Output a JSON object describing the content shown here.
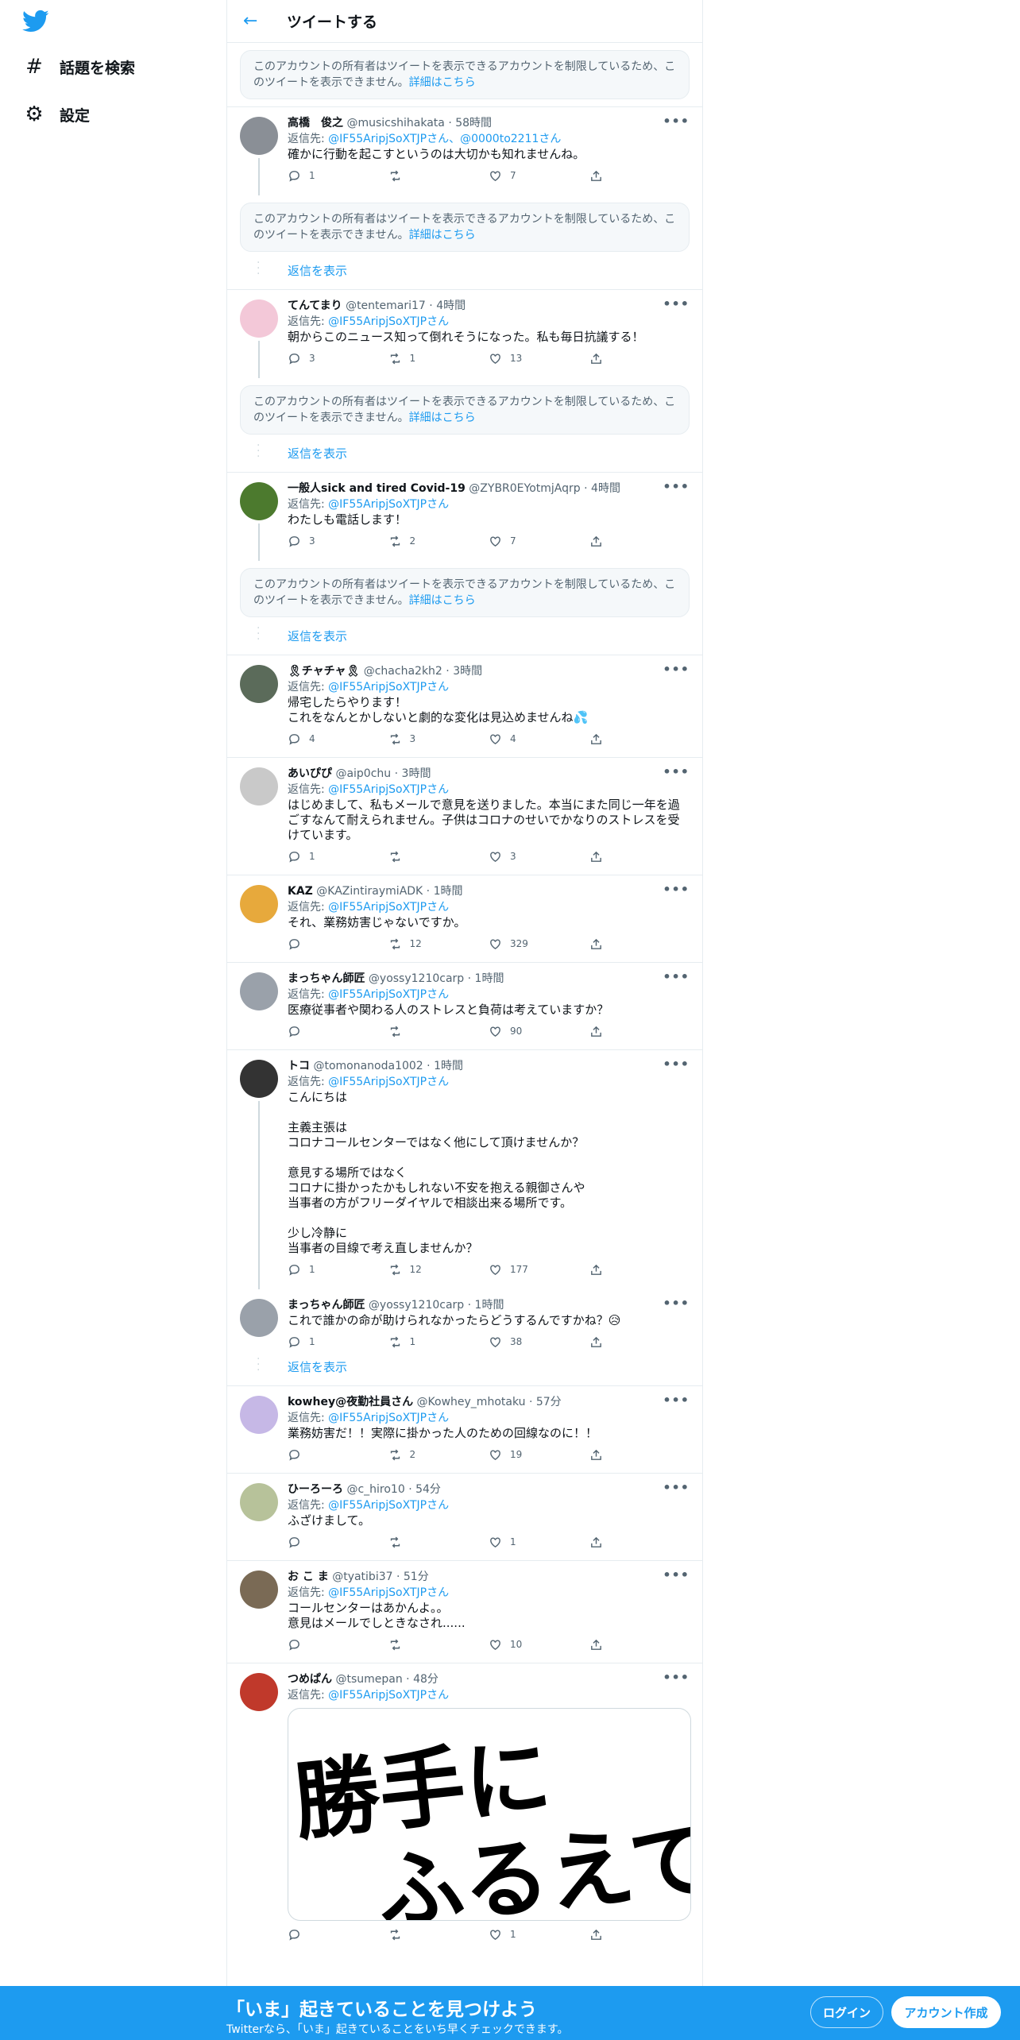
{
  "nav": {
    "explore": "話題を検索",
    "settings": "設定"
  },
  "header": {
    "title": "ツイートする"
  },
  "restricted": {
    "text": "このアカウントの所有者はツイートを表示できるアカウントを制限しているため、このツイートを表示できません。",
    "link": "詳細はこちら"
  },
  "show_replies": "返信を表示",
  "replying_to_label": "返信先:",
  "tweets": [
    {
      "name": "高橋　俊之",
      "handle": "@musicshihakata",
      "time": "58時間",
      "reply_to": "@IF55AripjSoXTJPさん、@0000to2211さん",
      "text": "確かに行動を起こすというのは大切かも知れませんね。",
      "replies": "1",
      "retweets": "",
      "likes": "7"
    },
    {
      "name": "てんてまり",
      "handle": "@tentemari17",
      "time": "4時間",
      "reply_to": "@IF55AripjSoXTJPさん",
      "text": "朝からこのニュース知って倒れそうになった。私も毎日抗議する！",
      "replies": "3",
      "retweets": "1",
      "likes": "13"
    },
    {
      "name": "一般人sick and tired Covid-19",
      "handle": "@ZYBR0EYotmjAqrp",
      "time": "4時間",
      "reply_to": "@IF55AripjSoXTJPさん",
      "text": "わたしも電話します！",
      "replies": "3",
      "retweets": "2",
      "likes": "7"
    },
    {
      "name": "🎗チャチャ🎗",
      "handle": "@chacha2kh2",
      "time": "3時間",
      "reply_to": "@IF55AripjSoXTJPさん",
      "text": "帰宅したらやります！\nこれをなんとかしないと劇的な変化は見込めませんね💦",
      "replies": "4",
      "retweets": "3",
      "likes": "4"
    },
    {
      "name": "あいぴぴ",
      "handle": "@aip0chu",
      "time": "3時間",
      "reply_to": "@IF55AripjSoXTJPさん",
      "text": "はじめまして、私もメールで意見を送りました。本当にまた同じ一年を過ごすなんて耐えられません。子供はコロナのせいでかなりのストレスを受けています。",
      "replies": "1",
      "retweets": "",
      "likes": "3"
    },
    {
      "name": "KAZ",
      "handle": "@KAZintiraymiADK",
      "time": "1時間",
      "reply_to": "@IF55AripjSoXTJPさん",
      "text": "それ、業務妨害じゃないですか。",
      "replies": "",
      "retweets": "12",
      "likes": "329"
    },
    {
      "name": "まっちゃん師匠",
      "handle": "@yossy1210carp",
      "time": "1時間",
      "reply_to": "@IF55AripjSoXTJPさん",
      "text": "医療従事者や関わる人のストレスと負荷は考えていますか？",
      "replies": "",
      "retweets": "",
      "likes": "90"
    },
    {
      "name": "トコ",
      "handle": "@tomonanoda1002",
      "time": "1時間",
      "reply_to": "@IF55AripjSoXTJPさん",
      "text": "こんにちは\n\n主義主張は\nコロナコールセンターではなく他にして頂けませんか？\n\n意見する場所ではなく\nコロナに掛かったかもしれない不安を抱える親御さんや\n当事者の方がフリーダイヤルで相談出来る場所です。\n\n少し冷静に\n当事者の目線で考え直しませんか？",
      "replies": "1",
      "retweets": "12",
      "likes": "177"
    },
    {
      "name": "まっちゃん師匠",
      "handle": "@yossy1210carp",
      "time": "1時間",
      "reply_to": "",
      "text": "これで誰かの命が助けられなかったらどうするんですかね？😥",
      "replies": "1",
      "retweets": "1",
      "likes": "38"
    },
    {
      "name": "kowhey@夜勤社員さん",
      "handle": "@Kowhey_mhotaku",
      "time": "57分",
      "reply_to": "@IF55AripjSoXTJPさん",
      "text": "業務妨害だ！！実際に掛かった人のための回線なのに！！",
      "replies": "",
      "retweets": "2",
      "likes": "19"
    },
    {
      "name": "ひーろーろ",
      "handle": "@c_hiro10",
      "time": "54分",
      "reply_to": "@IF55AripjSoXTJPさん",
      "text": "ふざけまして。",
      "replies": "",
      "retweets": "",
      "likes": "1"
    },
    {
      "name": "お こ ま",
      "handle": "@tyatibi37",
      "time": "51分",
      "reply_to": "@IF55AripjSoXTJPさん",
      "text": "コールセンターはあかんよ。。\n意見はメールでしときなされ......",
      "replies": "",
      "retweets": "",
      "likes": "10"
    },
    {
      "name": "つめぱん",
      "handle": "@tsumepan",
      "time": "48分",
      "reply_to": "@IF55AripjSoXTJPさん",
      "text": "",
      "media_text": "勝手にふるえてろ",
      "replies": "",
      "retweets": "",
      "likes": "1"
    }
  ],
  "banner": {
    "title": "「いま」起きていることを見つけよう",
    "subtitle": "Twitterなら、「いま」起きていることをいち早くチェックできます。",
    "login": "ログイン",
    "signup": "アカウント作成"
  },
  "colors": {
    "accent": "#1d9bf0",
    "border": "#e6ecf0",
    "muted": "#536471"
  }
}
